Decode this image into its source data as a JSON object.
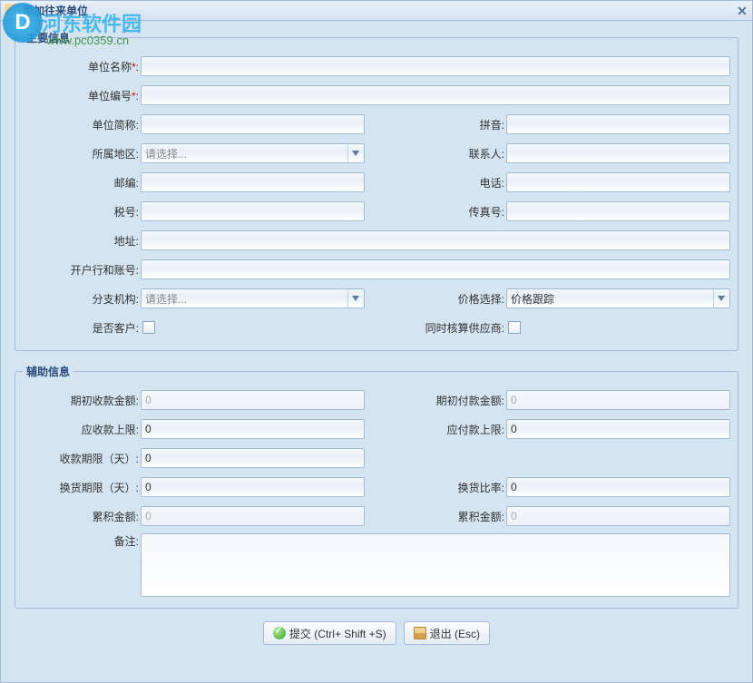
{
  "window": {
    "title": "添加往来单位"
  },
  "watermark": {
    "brand": "河东软件园",
    "url": "www.pc0359.cn",
    "logo_letter": "D"
  },
  "main": {
    "legend": "主要信息",
    "unit_name": {
      "label": "单位名称",
      "value": ""
    },
    "unit_code": {
      "label": "单位编号",
      "value": ""
    },
    "short_name": {
      "label": "单位简称:",
      "value": ""
    },
    "pinyin": {
      "label": "拼音:",
      "value": ""
    },
    "region": {
      "label": "所属地区:",
      "placeholder": "请选择..."
    },
    "contact": {
      "label": "联系人:",
      "value": ""
    },
    "postcode": {
      "label": "邮编:",
      "value": ""
    },
    "phone": {
      "label": "电话:",
      "value": ""
    },
    "tax_no": {
      "label": "税号:",
      "value": ""
    },
    "fax": {
      "label": "传真号:",
      "value": ""
    },
    "address": {
      "label": "地址:",
      "value": ""
    },
    "bank_account": {
      "label": "开户行和账号:",
      "value": ""
    },
    "branch": {
      "label": "分支机构:",
      "placeholder": "请选择..."
    },
    "price_select": {
      "label": "价格选择:",
      "value": "价格跟踪"
    },
    "is_customer": {
      "label": "是否客户:"
    },
    "also_supplier": {
      "label": "同时核算供应商:"
    }
  },
  "aux": {
    "legend": "辅助信息",
    "init_receive": {
      "label": "期初收款金额:",
      "value": "0"
    },
    "init_pay": {
      "label": "期初付款金额:",
      "value": "0"
    },
    "receive_limit": {
      "label": "应收款上限:",
      "value": "0"
    },
    "pay_limit": {
      "label": "应付款上限:",
      "value": "0"
    },
    "receive_days": {
      "label": "收款期限（天）:",
      "value": "0"
    },
    "exchange_days": {
      "label": "换货期限（天）:",
      "value": "0"
    },
    "exchange_ratio": {
      "label": "换货比率:",
      "value": "0"
    },
    "accum_amount_l": {
      "label": "累积金额:",
      "value": "0"
    },
    "accum_amount_r": {
      "label": "累积金额:",
      "value": "0"
    },
    "remark": {
      "label": "备注:",
      "value": ""
    }
  },
  "buttons": {
    "submit": "提交 (Ctrl+ Shift +S)",
    "exit": "退出 (Esc)"
  }
}
